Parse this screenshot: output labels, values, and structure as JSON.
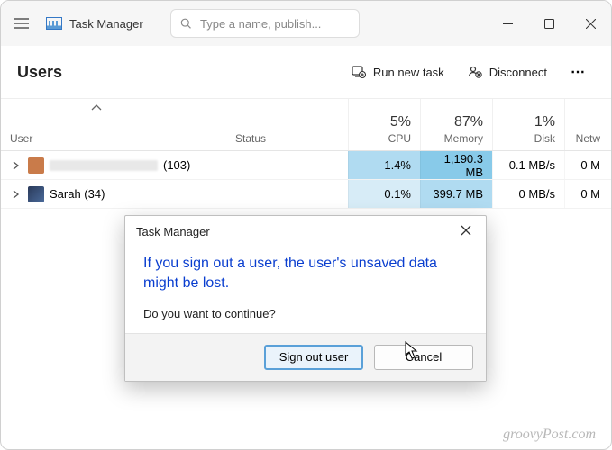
{
  "titlebar": {
    "app_name": "Task Manager",
    "search_placeholder": "Type a name, publish..."
  },
  "toolbar": {
    "section": "Users",
    "run_new_task": "Run new task",
    "disconnect": "Disconnect",
    "more": "⋯"
  },
  "columns": {
    "user": "User",
    "status": "Status",
    "cpu": {
      "value": "5%",
      "label": "CPU"
    },
    "memory": {
      "value": "87%",
      "label": "Memory"
    },
    "disk": {
      "value": "1%",
      "label": "Disk"
    },
    "network": {
      "label": "Netw"
    }
  },
  "rows": [
    {
      "name_suffix": "(103)",
      "redacted": true,
      "cpu": "1.4%",
      "memory": "1,190.3 MB",
      "disk": "0.1 MB/s",
      "network": "0 M"
    },
    {
      "name": "Sarah (34)",
      "redacted": false,
      "cpu": "0.1%",
      "memory": "399.7 MB",
      "disk": "0 MB/s",
      "network": "0 M"
    }
  ],
  "dialog": {
    "title": "Task Manager",
    "warning": "If you sign out a user, the user's unsaved data might be lost.",
    "prompt": "Do you want to continue?",
    "confirm": "Sign out user",
    "cancel": "Cancel"
  },
  "watermark": "groovyPost.com"
}
